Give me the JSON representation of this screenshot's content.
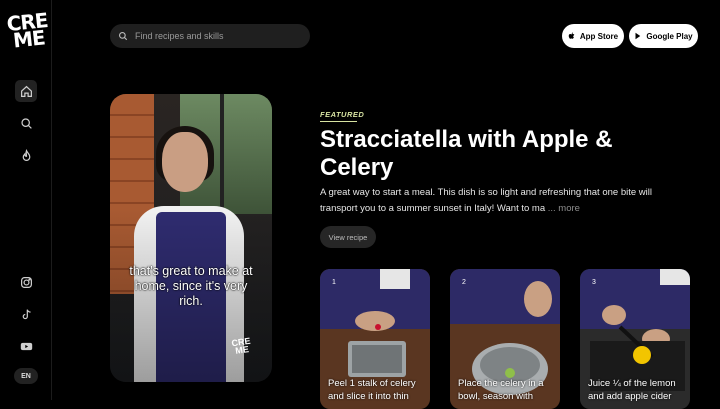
{
  "brand": {
    "logo_lines": [
      "CRE",
      "ME"
    ]
  },
  "sidebar": {
    "nav": [
      {
        "name": "home",
        "icon": "home-icon",
        "active": true
      },
      {
        "name": "search",
        "icon": "search-icon",
        "active": false
      },
      {
        "name": "trending",
        "icon": "flame-icon",
        "active": false
      }
    ],
    "social": [
      {
        "name": "instagram",
        "icon": "instagram-icon"
      },
      {
        "name": "tiktok",
        "icon": "tiktok-icon"
      },
      {
        "name": "youtube",
        "icon": "youtube-icon"
      }
    ],
    "language": "EN"
  },
  "header": {
    "search_placeholder": "Find recipes and skills",
    "app_store_label": "App Store",
    "google_play_label": "Google Play"
  },
  "hero": {
    "subtitle": "that's great to make at home, since it's very rich.",
    "watermark": [
      "CRE",
      "ME"
    ]
  },
  "featured": {
    "tag": "FEATURED",
    "title": "Stracciatella with Apple & Celery",
    "description": "A great way to start a meal. This dish is so light and refreshing that one bite will transport you to a summer sunset in Italy! Want to ma",
    "more_label": "... more",
    "view_button": "View recipe"
  },
  "steps": [
    {
      "number": "1",
      "text": "Peel 1 stalk of celery and slice it into thin"
    },
    {
      "number": "2",
      "text": "Place the celery in a bowl, season with"
    },
    {
      "number": "3",
      "text": "Juice ¼ of the lemon and add apple cider"
    }
  ],
  "colors": {
    "background": "#000000",
    "accent": "#d7e3a2",
    "apron": "#2f2c70"
  }
}
